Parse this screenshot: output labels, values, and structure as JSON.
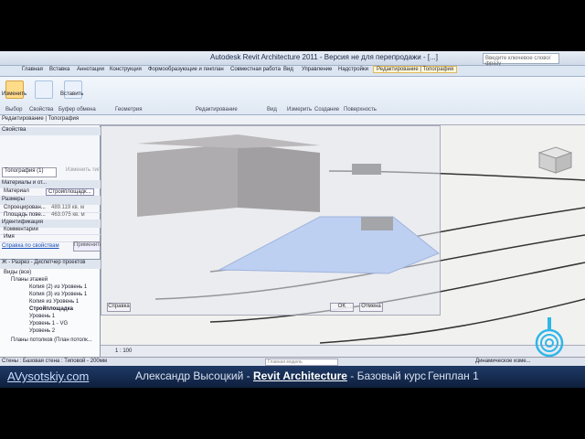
{
  "window": {
    "title": "Autodesk Revit Architecture 2011 - Версия не для перепродажи - [...]",
    "help_search_placeholder": "Введите ключевое слово/фразу"
  },
  "ribbon_tabs": [
    "Главная",
    "Вставка",
    "Аннотации",
    "Конструкция",
    "Формообразующие и генплан",
    "Совместная работа",
    "Вид",
    "Управление",
    "Надстройки",
    "Редактирование | Топография"
  ],
  "ribbon": {
    "panels": [
      "Выбор",
      "Свойства",
      "Буфер обмена",
      "Геометрия",
      "Редактирование",
      "Вид",
      "Измерить",
      "Создание",
      "Поверхность"
    ],
    "buttons": {
      "modify": "Изменить",
      "paste": "Вставить"
    }
  },
  "context_bar": "Редактирование | Топография",
  "properties": {
    "header": "Свойства",
    "type_selector": "Топография (1)",
    "edit_type": "Изменить тип",
    "section_materials": "Материалы и от...",
    "material_key": "Материал",
    "material_value": "Стройплощадк...",
    "section_sizes": "Размеры",
    "rows": [
      {
        "k": "Спроецирован...",
        "v": "489.119 кв. м"
      },
      {
        "k": "Площадь пове...",
        "v": "463.075 кв. м"
      }
    ],
    "section_identity": "Идентификация",
    "comments": "Комментарии",
    "name": "Имя",
    "help_link": "Справка по свойствам",
    "apply": "Применить"
  },
  "project_browser": {
    "header": "Ж - Разрез - Диспетчер проектов",
    "items": [
      {
        "label": "Виды (все)",
        "level": 0
      },
      {
        "label": "Планы этажей",
        "level": 1
      },
      {
        "label": "Копия (2) из Уровень 1",
        "level": 2
      },
      {
        "label": "Копия (3) из Уровень 1",
        "level": 2
      },
      {
        "label": "Копия из Уровень 1",
        "level": 2
      },
      {
        "label": "Стройплощадка",
        "level": 2
      },
      {
        "label": "Уровень 1",
        "level": 2
      },
      {
        "label": "Уровень 1 - VG",
        "level": 2
      },
      {
        "label": "Уровень 2",
        "level": 2
      },
      {
        "label": "Планы потолков (План потолк...",
        "level": 1
      }
    ]
  },
  "dialog": {
    "ok": "OK",
    "cancel": "Отмена",
    "help": "Справка"
  },
  "view": {
    "scale": "1 : 100"
  },
  "status": {
    "left": "Стены : Базовая стена : Типовой - 200мм",
    "model": "Главная модель",
    "dynamic": "Динамическое изме..."
  },
  "caption": {
    "site": "AVysotskiy.com",
    "author_prefix": "Александр Высоцкий - ",
    "product": "Revit Architecture",
    "author_suffix": " - Базовый курс",
    "lesson": "Генплан 1"
  },
  "colors": {
    "caption_bg": "#0e1f3d",
    "surface": "#8fb4f5",
    "building": "#6b6461"
  },
  "icons": [
    "app-menu-icon",
    "modify-icon",
    "properties-icon",
    "paste-icon",
    "view-cube-icon",
    "spiral-logo-icon"
  ]
}
